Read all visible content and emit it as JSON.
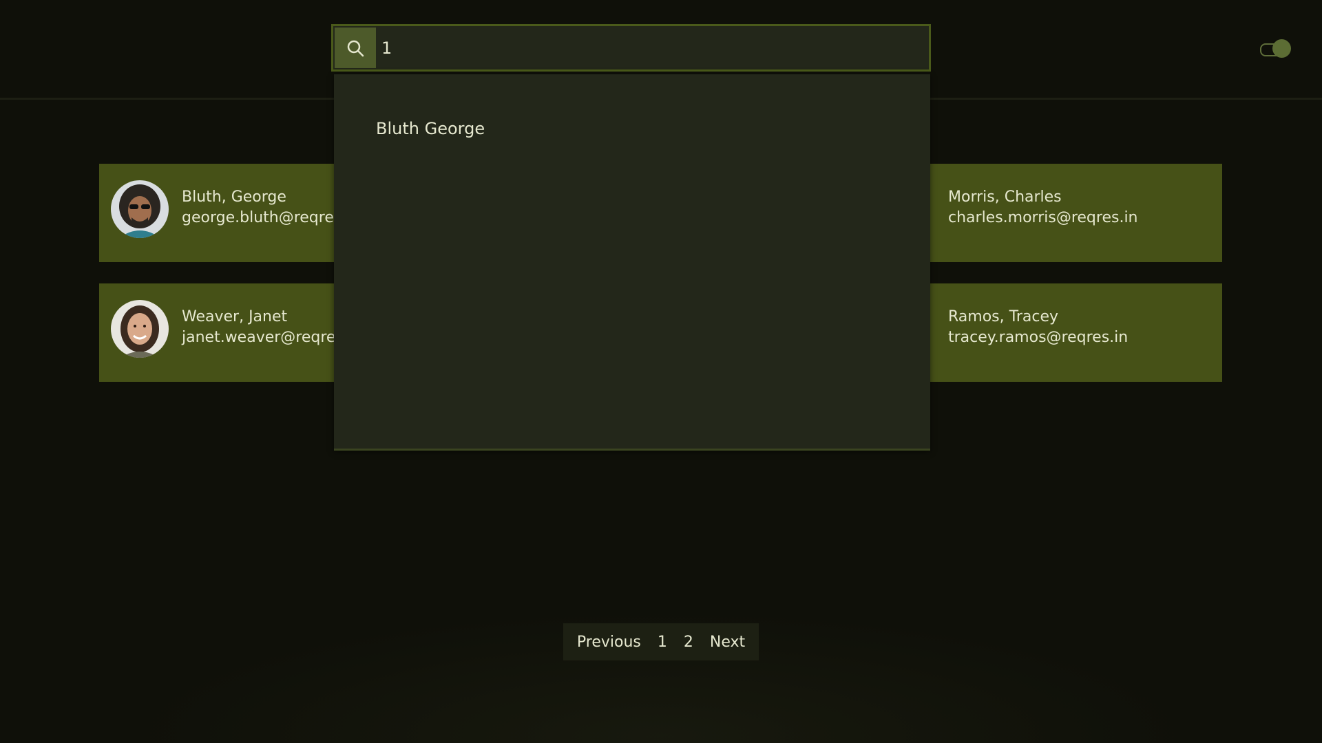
{
  "search": {
    "value": "1",
    "icon": "search-icon"
  },
  "theme_toggle": {
    "state": "on",
    "color": "#5c6d34"
  },
  "users": [
    {
      "name": "Bluth, George",
      "email": "george.bluth@reqres.i"
    },
    {
      "name": "Morris, Charles",
      "email": "charles.morris@reqres.in"
    },
    {
      "name": "Weaver, Janet",
      "email": "janet.weaver@reqres.i"
    },
    {
      "name": "Ramos, Tracey",
      "email": "tracey.ramos@reqres.in"
    }
  ],
  "dropdown": {
    "items": [
      "Bluth George"
    ]
  },
  "pagination": {
    "previous": "Previous",
    "pages": [
      "1",
      "2"
    ],
    "next": "Next"
  },
  "colors": {
    "background": "#0f1009",
    "card": "#465117",
    "accent": "#4d5a2a",
    "dropdown": "#23271a"
  }
}
